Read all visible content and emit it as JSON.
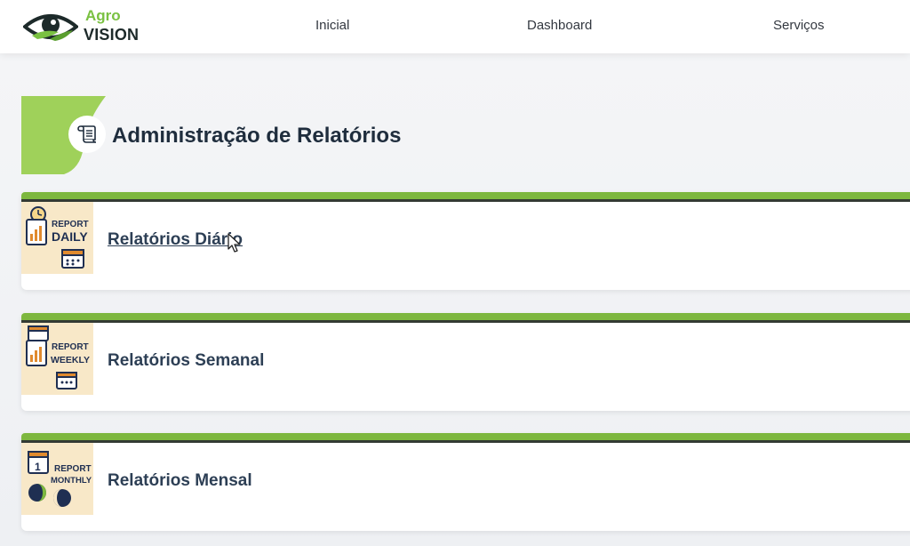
{
  "brand": {
    "name_top": "Agro",
    "name_bottom": "VISION",
    "accent_color": "#7ac142"
  },
  "nav": {
    "items": [
      {
        "label": "Inicial"
      },
      {
        "label": "Dashboard"
      },
      {
        "label": "Serviços"
      }
    ]
  },
  "page": {
    "title": "Administração de Relatórios",
    "title_icon": "scroll-icon"
  },
  "reports": [
    {
      "label": "Relatórios Diário",
      "thumb_line1": "REPORT",
      "thumb_line2": "DAILY",
      "icon": "report-daily-icon"
    },
    {
      "label": "Relatórios Semanal",
      "thumb_line1": "REPORT",
      "thumb_line2": "WEEKLY",
      "icon": "report-weekly-icon"
    },
    {
      "label": "Relatórios Mensal",
      "thumb_line1": "REPORT",
      "thumb_line2": "MONTHLY",
      "thumb_day": "1",
      "icon": "report-monthly-icon"
    }
  ],
  "colors": {
    "card_green": "#7db73e",
    "title_text": "#1f2d3d",
    "card_text": "#2d3f55",
    "thumb_bg": "#f8e8c8"
  }
}
